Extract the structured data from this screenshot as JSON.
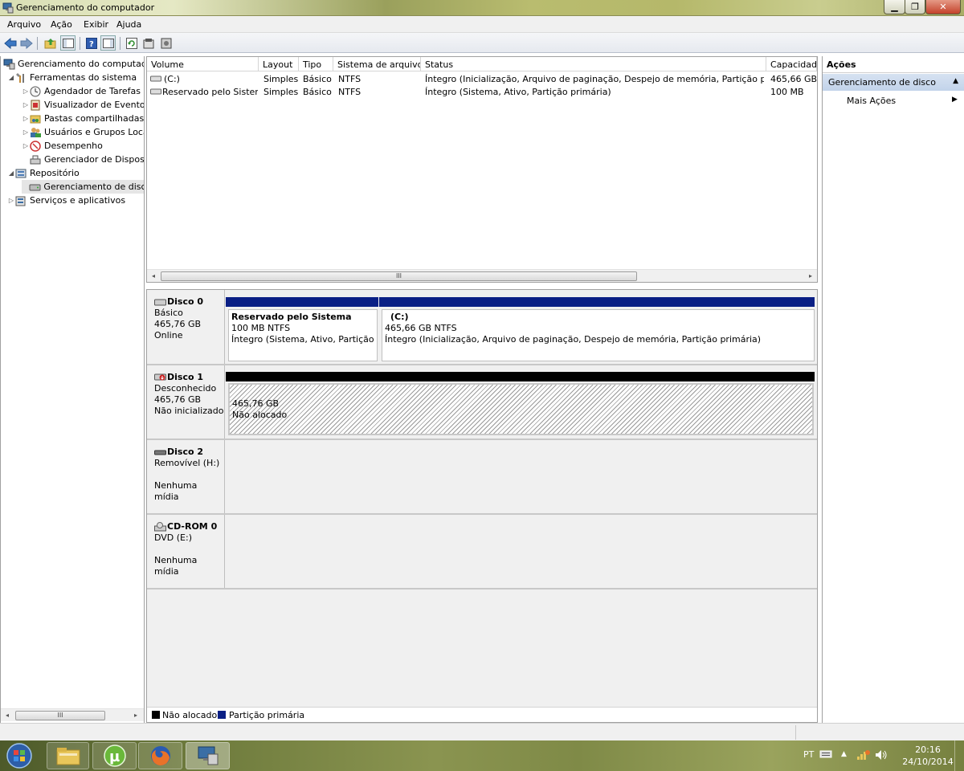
{
  "window": {
    "title": "Gerenciamento do computador"
  },
  "menu": [
    "Arquivo",
    "Ação",
    "Exibir",
    "Ajuda"
  ],
  "tree": [
    {
      "label": "Gerenciamento do computado",
      "level": 0,
      "arrow": ""
    },
    {
      "label": "Ferramentas do sistema",
      "level": 1,
      "arrow": "◢"
    },
    {
      "label": "Agendador de Tarefas",
      "level": 2,
      "arrow": "▷"
    },
    {
      "label": "Visualizador de Eventos",
      "level": 2,
      "arrow": "▷"
    },
    {
      "label": "Pastas compartilhadas",
      "level": 2,
      "arrow": "▷"
    },
    {
      "label": "Usuários e Grupos Loca",
      "level": 2,
      "arrow": "▷"
    },
    {
      "label": "Desempenho",
      "level": 2,
      "arrow": "▷"
    },
    {
      "label": "Gerenciador de Disposit",
      "level": 2,
      "arrow": ""
    },
    {
      "label": "Repositório",
      "level": 1,
      "arrow": "◢"
    },
    {
      "label": "Gerenciamento de disco",
      "level": 2,
      "arrow": ""
    },
    {
      "label": "Serviços e aplicativos",
      "level": 1,
      "arrow": "▷"
    }
  ],
  "volume_table": {
    "columns": [
      "Volume",
      "Layout",
      "Tipo",
      "Sistema de arquivos",
      "Status",
      "Capacidade"
    ],
    "rows": [
      [
        "(C:)",
        "Simples",
        "Básico",
        "NTFS",
        "Íntegro (Inicialização, Arquivo de paginação, Despejo de memória, Partição primária)",
        "465,66 GB"
      ],
      [
        "Reservado pelo Sistema",
        "Simples",
        "Básico",
        "NTFS",
        "Íntegro (Sistema, Ativo, Partição primária)",
        "100 MB"
      ]
    ]
  },
  "scroll_thumb_label": "III",
  "disks": [
    {
      "name": "Disco 0",
      "lines": [
        "Básico",
        "465,76 GB",
        "Online"
      ],
      "partitions": [
        {
          "title": "Reservado pelo Sistema",
          "lines": [
            "100 MB NTFS",
            "Íntegro (Sistema, Ativo, Partição prin"
          ],
          "bar_color": "#0a1f85"
        },
        {
          "title": "(C:)",
          "lines": [
            "465,66 GB NTFS",
            "Íntegro (Inicialização, Arquivo de paginação, Despejo de memória, Partição primária)"
          ],
          "bar_color": "#0a1f85"
        }
      ]
    },
    {
      "name": "Disco 1",
      "lines": [
        "Desconhecido",
        "465,76 GB",
        "Não inicializado"
      ],
      "partitions": [
        {
          "title": "",
          "lines": [
            "465,76 GB",
            "Não alocado"
          ],
          "bar_color": "#000000"
        }
      ]
    },
    {
      "name": "Disco 2",
      "lines": [
        "Removível (H:)",
        "",
        "Nenhuma mídia"
      ],
      "partitions": []
    },
    {
      "name": "CD-ROM 0",
      "lines": [
        "DVD (E:)",
        "",
        "Nenhuma mídia"
      ],
      "partitions": []
    }
  ],
  "legend": [
    {
      "label": "Não alocado",
      "color": "#000000"
    },
    {
      "label": "Partição primária",
      "color": "#0a1f85"
    }
  ],
  "actions": {
    "title": "Ações",
    "section": "Gerenciamento de disco",
    "more": "Mais Ações"
  },
  "taskbar": {
    "language": "PT",
    "time": "20:16",
    "date": "24/10/2014"
  }
}
